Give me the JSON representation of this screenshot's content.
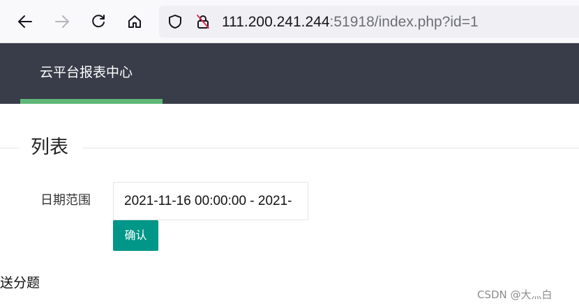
{
  "browser": {
    "url_host": "111.200.241.244",
    "url_rest": ":51918/index.php?id=1",
    "icons": [
      "back-arrow-icon",
      "forward-arrow-icon",
      "reload-icon",
      "home-icon",
      "shield-icon",
      "insecure-lock-icon"
    ]
  },
  "header": {
    "title": "云平台报表中心",
    "background": "#393d49",
    "indicator_color": "#5fb878"
  },
  "section": {
    "legend": "列表"
  },
  "form": {
    "date_label": "日期范围",
    "date_value": "2021-11-16 00:00:00 - 2021-",
    "confirm_label": "确认",
    "button_color": "#009688"
  },
  "footer_text": "送分题",
  "watermark": "CSDN @大灬白"
}
